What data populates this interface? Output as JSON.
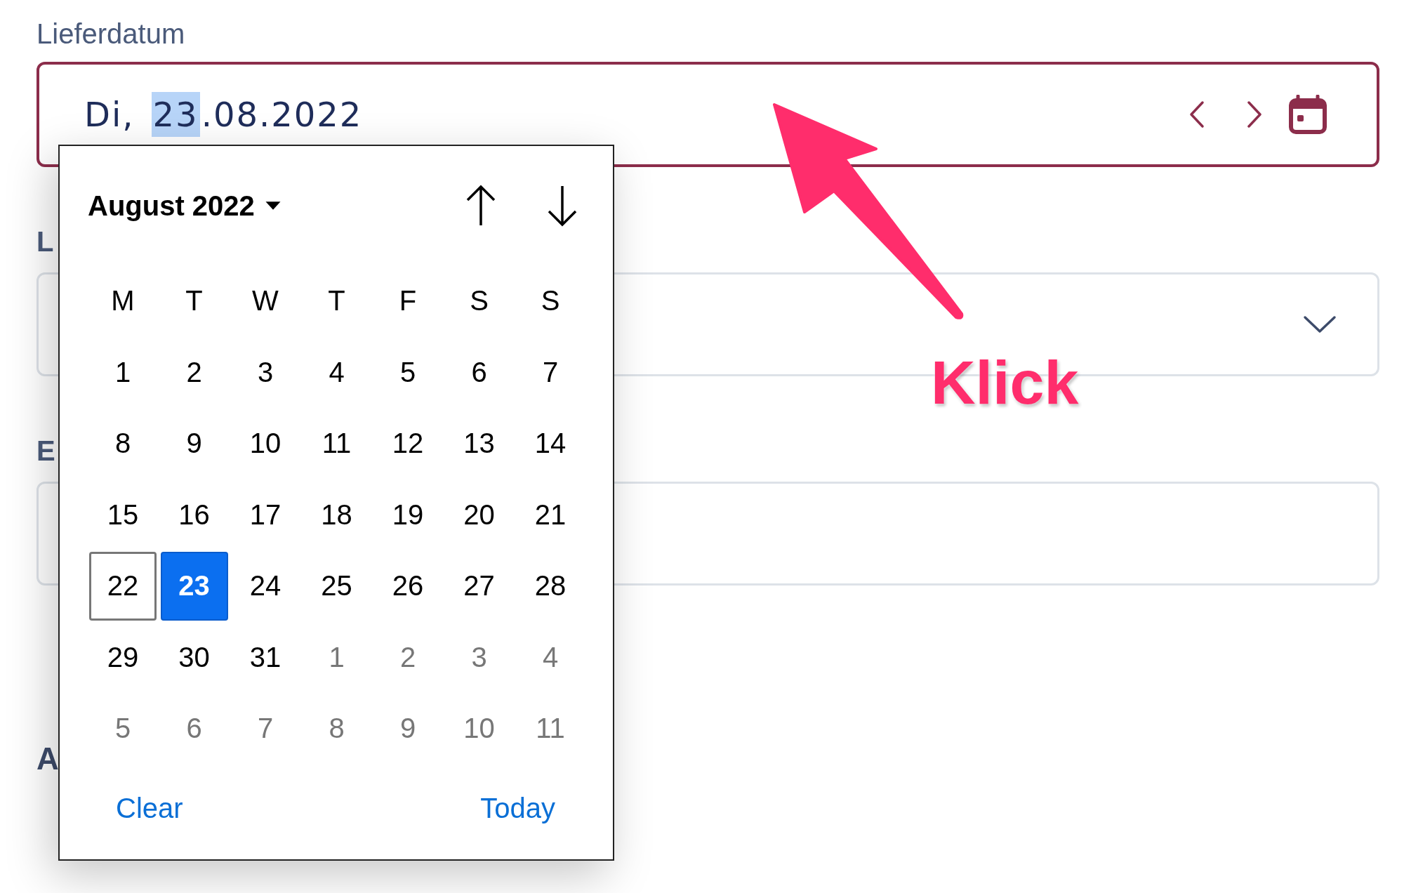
{
  "date_field": {
    "label": "Lieferdatum",
    "segments": [
      {
        "text": "Di,",
        "highlighted": false
      },
      {
        "text": "23",
        "highlighted": true
      },
      {
        "text": ".08.2022",
        "highlighted": false
      }
    ],
    "focused": true
  },
  "fields": [
    {
      "label": "L",
      "kind": "select"
    },
    {
      "label": "E",
      "kind": "text"
    }
  ],
  "section_label": "A",
  "calendar": {
    "month": "August 2022",
    "weekdays": [
      "M",
      "T",
      "W",
      "T",
      "F",
      "S",
      "S"
    ],
    "days": [
      {
        "label": "1",
        "muted": false,
        "selected": false,
        "current": false
      },
      {
        "label": "2",
        "muted": false,
        "selected": false,
        "current": false
      },
      {
        "label": "3",
        "muted": false,
        "selected": false,
        "current": false
      },
      {
        "label": "4",
        "muted": false,
        "selected": false,
        "current": false
      },
      {
        "label": "5",
        "muted": false,
        "selected": false,
        "current": false
      },
      {
        "label": "6",
        "muted": false,
        "selected": false,
        "current": false
      },
      {
        "label": "7",
        "muted": false,
        "selected": false,
        "current": false
      },
      {
        "label": "8",
        "muted": false,
        "selected": false,
        "current": false
      },
      {
        "label": "9",
        "muted": false,
        "selected": false,
        "current": false
      },
      {
        "label": "10",
        "muted": false,
        "selected": false,
        "current": false
      },
      {
        "label": "11",
        "muted": false,
        "selected": false,
        "current": false
      },
      {
        "label": "12",
        "muted": false,
        "selected": false,
        "current": false
      },
      {
        "label": "13",
        "muted": false,
        "selected": false,
        "current": false
      },
      {
        "label": "14",
        "muted": false,
        "selected": false,
        "current": false
      },
      {
        "label": "15",
        "muted": false,
        "selected": false,
        "current": false
      },
      {
        "label": "16",
        "muted": false,
        "selected": false,
        "current": false
      },
      {
        "label": "17",
        "muted": false,
        "selected": false,
        "current": false
      },
      {
        "label": "18",
        "muted": false,
        "selected": false,
        "current": false
      },
      {
        "label": "19",
        "muted": false,
        "selected": false,
        "current": false
      },
      {
        "label": "20",
        "muted": false,
        "selected": false,
        "current": false
      },
      {
        "label": "21",
        "muted": false,
        "selected": false,
        "current": false
      },
      {
        "label": "22",
        "muted": false,
        "selected": false,
        "current": true
      },
      {
        "label": "23",
        "muted": false,
        "selected": true,
        "current": false
      },
      {
        "label": "24",
        "muted": false,
        "selected": false,
        "current": false
      },
      {
        "label": "25",
        "muted": false,
        "selected": false,
        "current": false
      },
      {
        "label": "26",
        "muted": false,
        "selected": false,
        "current": false
      },
      {
        "label": "27",
        "muted": false,
        "selected": false,
        "current": false
      },
      {
        "label": "28",
        "muted": false,
        "selected": false,
        "current": false
      },
      {
        "label": "29",
        "muted": false,
        "selected": false,
        "current": false
      },
      {
        "label": "30",
        "muted": false,
        "selected": false,
        "current": false
      },
      {
        "label": "31",
        "muted": false,
        "selected": false,
        "current": false
      },
      {
        "label": "1",
        "muted": true,
        "selected": false,
        "current": false
      },
      {
        "label": "2",
        "muted": true,
        "selected": false,
        "current": false
      },
      {
        "label": "3",
        "muted": true,
        "selected": false,
        "current": false
      },
      {
        "label": "4",
        "muted": true,
        "selected": false,
        "current": false
      },
      {
        "label": "5",
        "muted": true,
        "selected": false,
        "current": false
      },
      {
        "label": "6",
        "muted": true,
        "selected": false,
        "current": false
      },
      {
        "label": "7",
        "muted": true,
        "selected": false,
        "current": false
      },
      {
        "label": "8",
        "muted": true,
        "selected": false,
        "current": false
      },
      {
        "label": "9",
        "muted": true,
        "selected": false,
        "current": false
      },
      {
        "label": "10",
        "muted": true,
        "selected": false,
        "current": false
      },
      {
        "label": "11",
        "muted": true,
        "selected": false,
        "current": false
      }
    ],
    "clear": "Clear",
    "today": "Today"
  },
  "annotation": {
    "text": "Klick"
  }
}
